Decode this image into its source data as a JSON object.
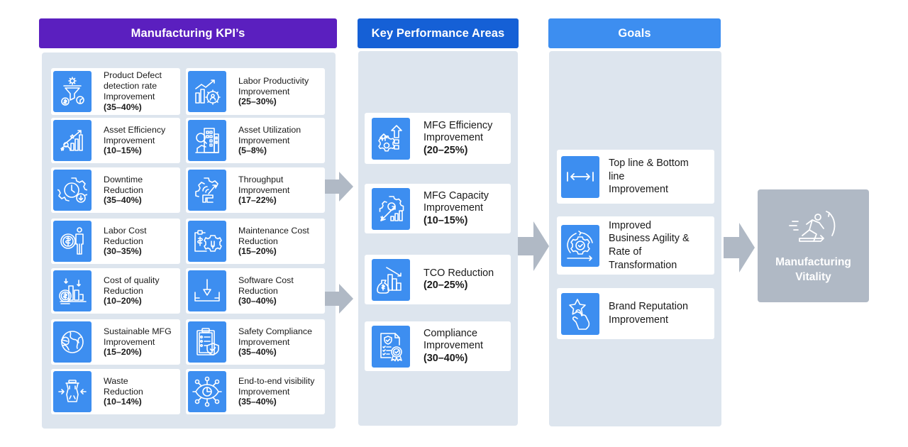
{
  "colors": {
    "kpi_header": "#5b1fbf",
    "kpa_header": "#1560d6",
    "goals_header": "#3d8ef0",
    "icon_bg": "#3d8ef0",
    "panel_bg": "#dde5ee",
    "arrow": "#b0b9c5",
    "vitality_bg": "#b0b9c5"
  },
  "kpis": {
    "title": "Manufacturing KPI’s",
    "items": [
      {
        "label": "Product Defect\ndetection rate\nImprovement",
        "value": "(35–40%)",
        "icon": "defect-funnel-icon"
      },
      {
        "label": "Labor Productivity\nImprovement",
        "value": "(25–30%)",
        "icon": "labor-productivity-icon"
      },
      {
        "label": "Asset Efficiency\nImprovement",
        "value": "(10–15%)",
        "icon": "growth-chart-icon"
      },
      {
        "label": "Asset Utilization\nImprovement",
        "value": "(5–8%)",
        "icon": "building-search-icon"
      },
      {
        "label": "Downtime\nReduction",
        "value": "(35–40%)",
        "icon": "gear-clock-icon"
      },
      {
        "label": "Throughput\nImprovement",
        "value": "(17–22%)",
        "icon": "gear-throughput-icon"
      },
      {
        "label": "Labor Cost\nReduction",
        "value": "(30–35%)",
        "icon": "coin-person-icon"
      },
      {
        "label": "Maintenance Cost\nReduction",
        "value": "(15–20%)",
        "icon": "clipboard-wrench-icon"
      },
      {
        "label": "Cost of quality\nReduction",
        "value": "(10–20%)",
        "icon": "coins-chart-icon"
      },
      {
        "label": "Software Cost\nReduction",
        "value": "(30–40%)",
        "icon": "download-tray-icon"
      },
      {
        "label": "Sustainable MFG\nImprovement",
        "value": "(15–20%)",
        "icon": "globe-leaf-icon"
      },
      {
        "label": "Safety Compliance\nImprovement",
        "value": "(35–40%)",
        "icon": "clipboard-shield-icon"
      },
      {
        "label": "Waste\nReduction",
        "value": "(10–14%)",
        "icon": "bin-compress-icon"
      },
      {
        "label": "End-to-end visibility\nImprovement",
        "value": "(35–40%)",
        "icon": "eye-network-icon"
      }
    ]
  },
  "kpas": {
    "title": "Key Performance Areas",
    "items": [
      {
        "label": "MFG Efficiency\nImprovement",
        "value": "(20–25%)",
        "icon": "gear-arrows-up-icon"
      },
      {
        "label": "MFG Capacity\nImprovement",
        "value": "(10–15%)",
        "icon": "gear-rocket-chart-icon"
      },
      {
        "label": "TCO Reduction",
        "value": "(20–25%)",
        "icon": "money-bag-decline-icon"
      },
      {
        "label": "Compliance\nImprovement",
        "value": "(30–40%)",
        "icon": "document-certificate-icon"
      }
    ]
  },
  "goals": {
    "title": "Goals",
    "items": [
      {
        "label": "Top line & Bottom\nline\nImprovement",
        "icon": "horizontal-range-icon"
      },
      {
        "label": "Improved\nBusiness Agility &\nRate of\nTransformation",
        "icon": "gear-check-cycle-icon"
      },
      {
        "label": "Brand Reputation\nImprovement",
        "icon": "hand-star-icon"
      }
    ]
  },
  "outcome": {
    "title": "Manufacturing\nVitality",
    "icon": "running-person-icon"
  }
}
